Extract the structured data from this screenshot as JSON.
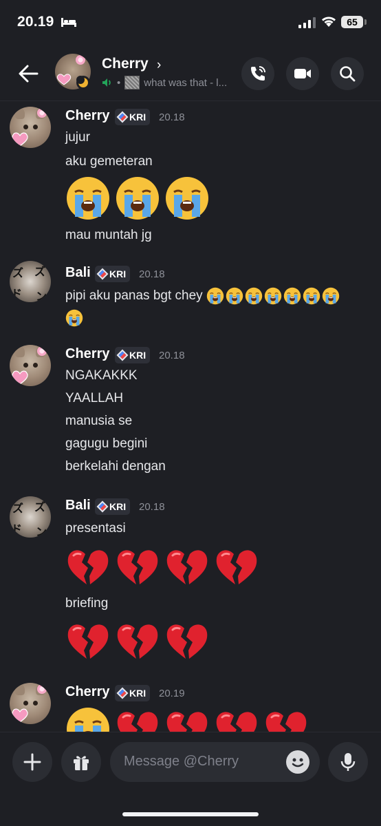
{
  "status_bar": {
    "time": "20.19",
    "battery": "65"
  },
  "header": {
    "contact_name": "Cherry",
    "chevron": "›",
    "activity_text": "what was that - l...",
    "buttons": [
      "phone-call-icon",
      "video-call-icon",
      "search-icon"
    ]
  },
  "messages": [
    {
      "author": "Cherry",
      "tag": "KRI",
      "time": "20.18",
      "lines": [
        "jujur",
        "aku gemeteran",
        "mau muntah jg"
      ],
      "emoji": "😭😭😭"
    },
    {
      "author": "Bali",
      "tag": "KRI",
      "time": "20.18",
      "lines": [
        "pipi aku panas bgt chey"
      ],
      "emoji": "😭😭😭😭😭😭😭😭"
    },
    {
      "author": "Cherry",
      "tag": "KRI",
      "time": "20.18",
      "lines": [
        "NGAKAKKK",
        "YAALLAH",
        "manusia se",
        "gagugu begini",
        "berkelahi dengan"
      ]
    },
    {
      "author": "Bali",
      "tag": "KRI",
      "time": "20.18",
      "lines": [
        "presentasi",
        "briefing"
      ],
      "emoji_a": "💔💔💔💔",
      "emoji_b": "💔💔💔"
    },
    {
      "author": "Cherry",
      "tag": "KRI",
      "time": "20.19",
      "emoji": "😭💔💔💔💔"
    }
  ],
  "composer": {
    "placeholder": "Message @Cherry"
  },
  "colors": {
    "background": "#1e1f24",
    "surface": "#2b2d33",
    "muted": "#8e9098",
    "online": "#23a55a",
    "idle": "#f0b232"
  }
}
